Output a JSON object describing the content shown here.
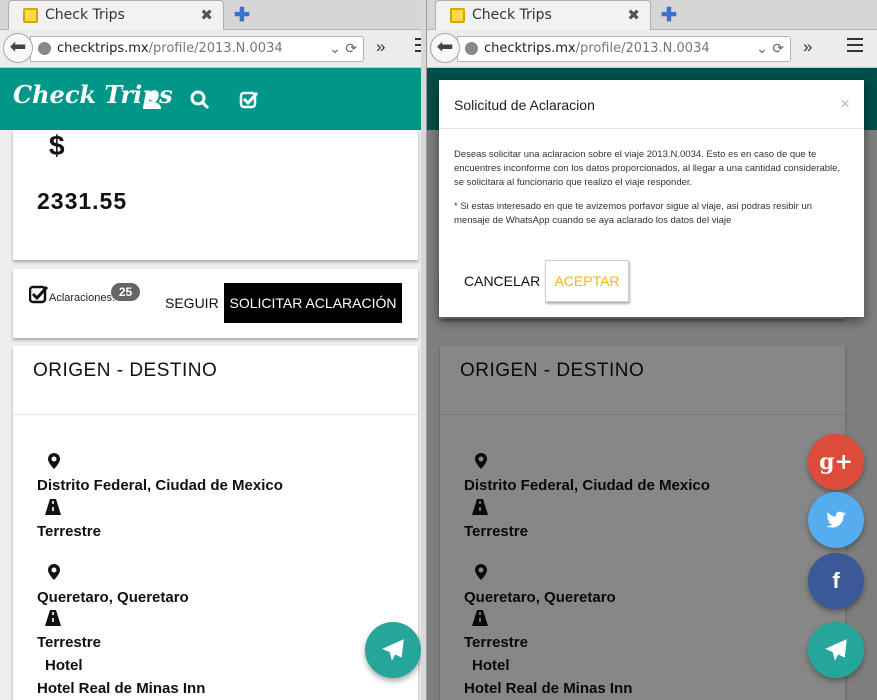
{
  "browser": {
    "tab_title": "Check Trips",
    "url_host": "checktrips.mx",
    "url_path": "/profile/2013.N.0034"
  },
  "app": {
    "brand": "Check Trips"
  },
  "costo": {
    "currency_symbol": "$",
    "amount": "2331.55"
  },
  "actions": {
    "aclaraciones_label": "Aclaraciones:",
    "aclaraciones_count": "25",
    "seguir_label": "SEGUIR",
    "solicitar_label": "SOLICITAR ACLARACIÓN"
  },
  "route": {
    "title": "ORIGEN - DESTINO",
    "origin": "Distrito Federal, Ciudad de Mexico",
    "transport_1": "Terrestre",
    "destination": "Queretaro, Queretaro",
    "transport_2": "Terrestre",
    "lodging_type": "Hotel",
    "lodging_name": "Hotel Real de Minas Inn"
  },
  "modal": {
    "title": "Solicitud de Aclaracion",
    "close": "×",
    "body": "Deseas solicitar una aclaracion sobre el viaje 2013.N.0034. Esto es en caso de que te encuentres inconforme con los datos proporcionados, al llegar a una cantidad considerable, se solicitara al funcionario que realizo el viaje responder.",
    "note": "* Si estas interesado en que te avizemos porfavor sigue al viaje, asi podras resibir un mensaje de WhatsApp cuando se aya aclarado los datos del viaje",
    "cancel_label": "CANCELAR",
    "accept_label": "ACEPTAR"
  },
  "share": {
    "google_plus": "g+",
    "twitter_color": "#55acee",
    "facebook": "f",
    "google_color": "#dd4b39",
    "facebook_color": "#3b5998",
    "send_color": "#26a69a"
  },
  "theme": {
    "primary": "#009688",
    "accent": "#f2b90a"
  }
}
